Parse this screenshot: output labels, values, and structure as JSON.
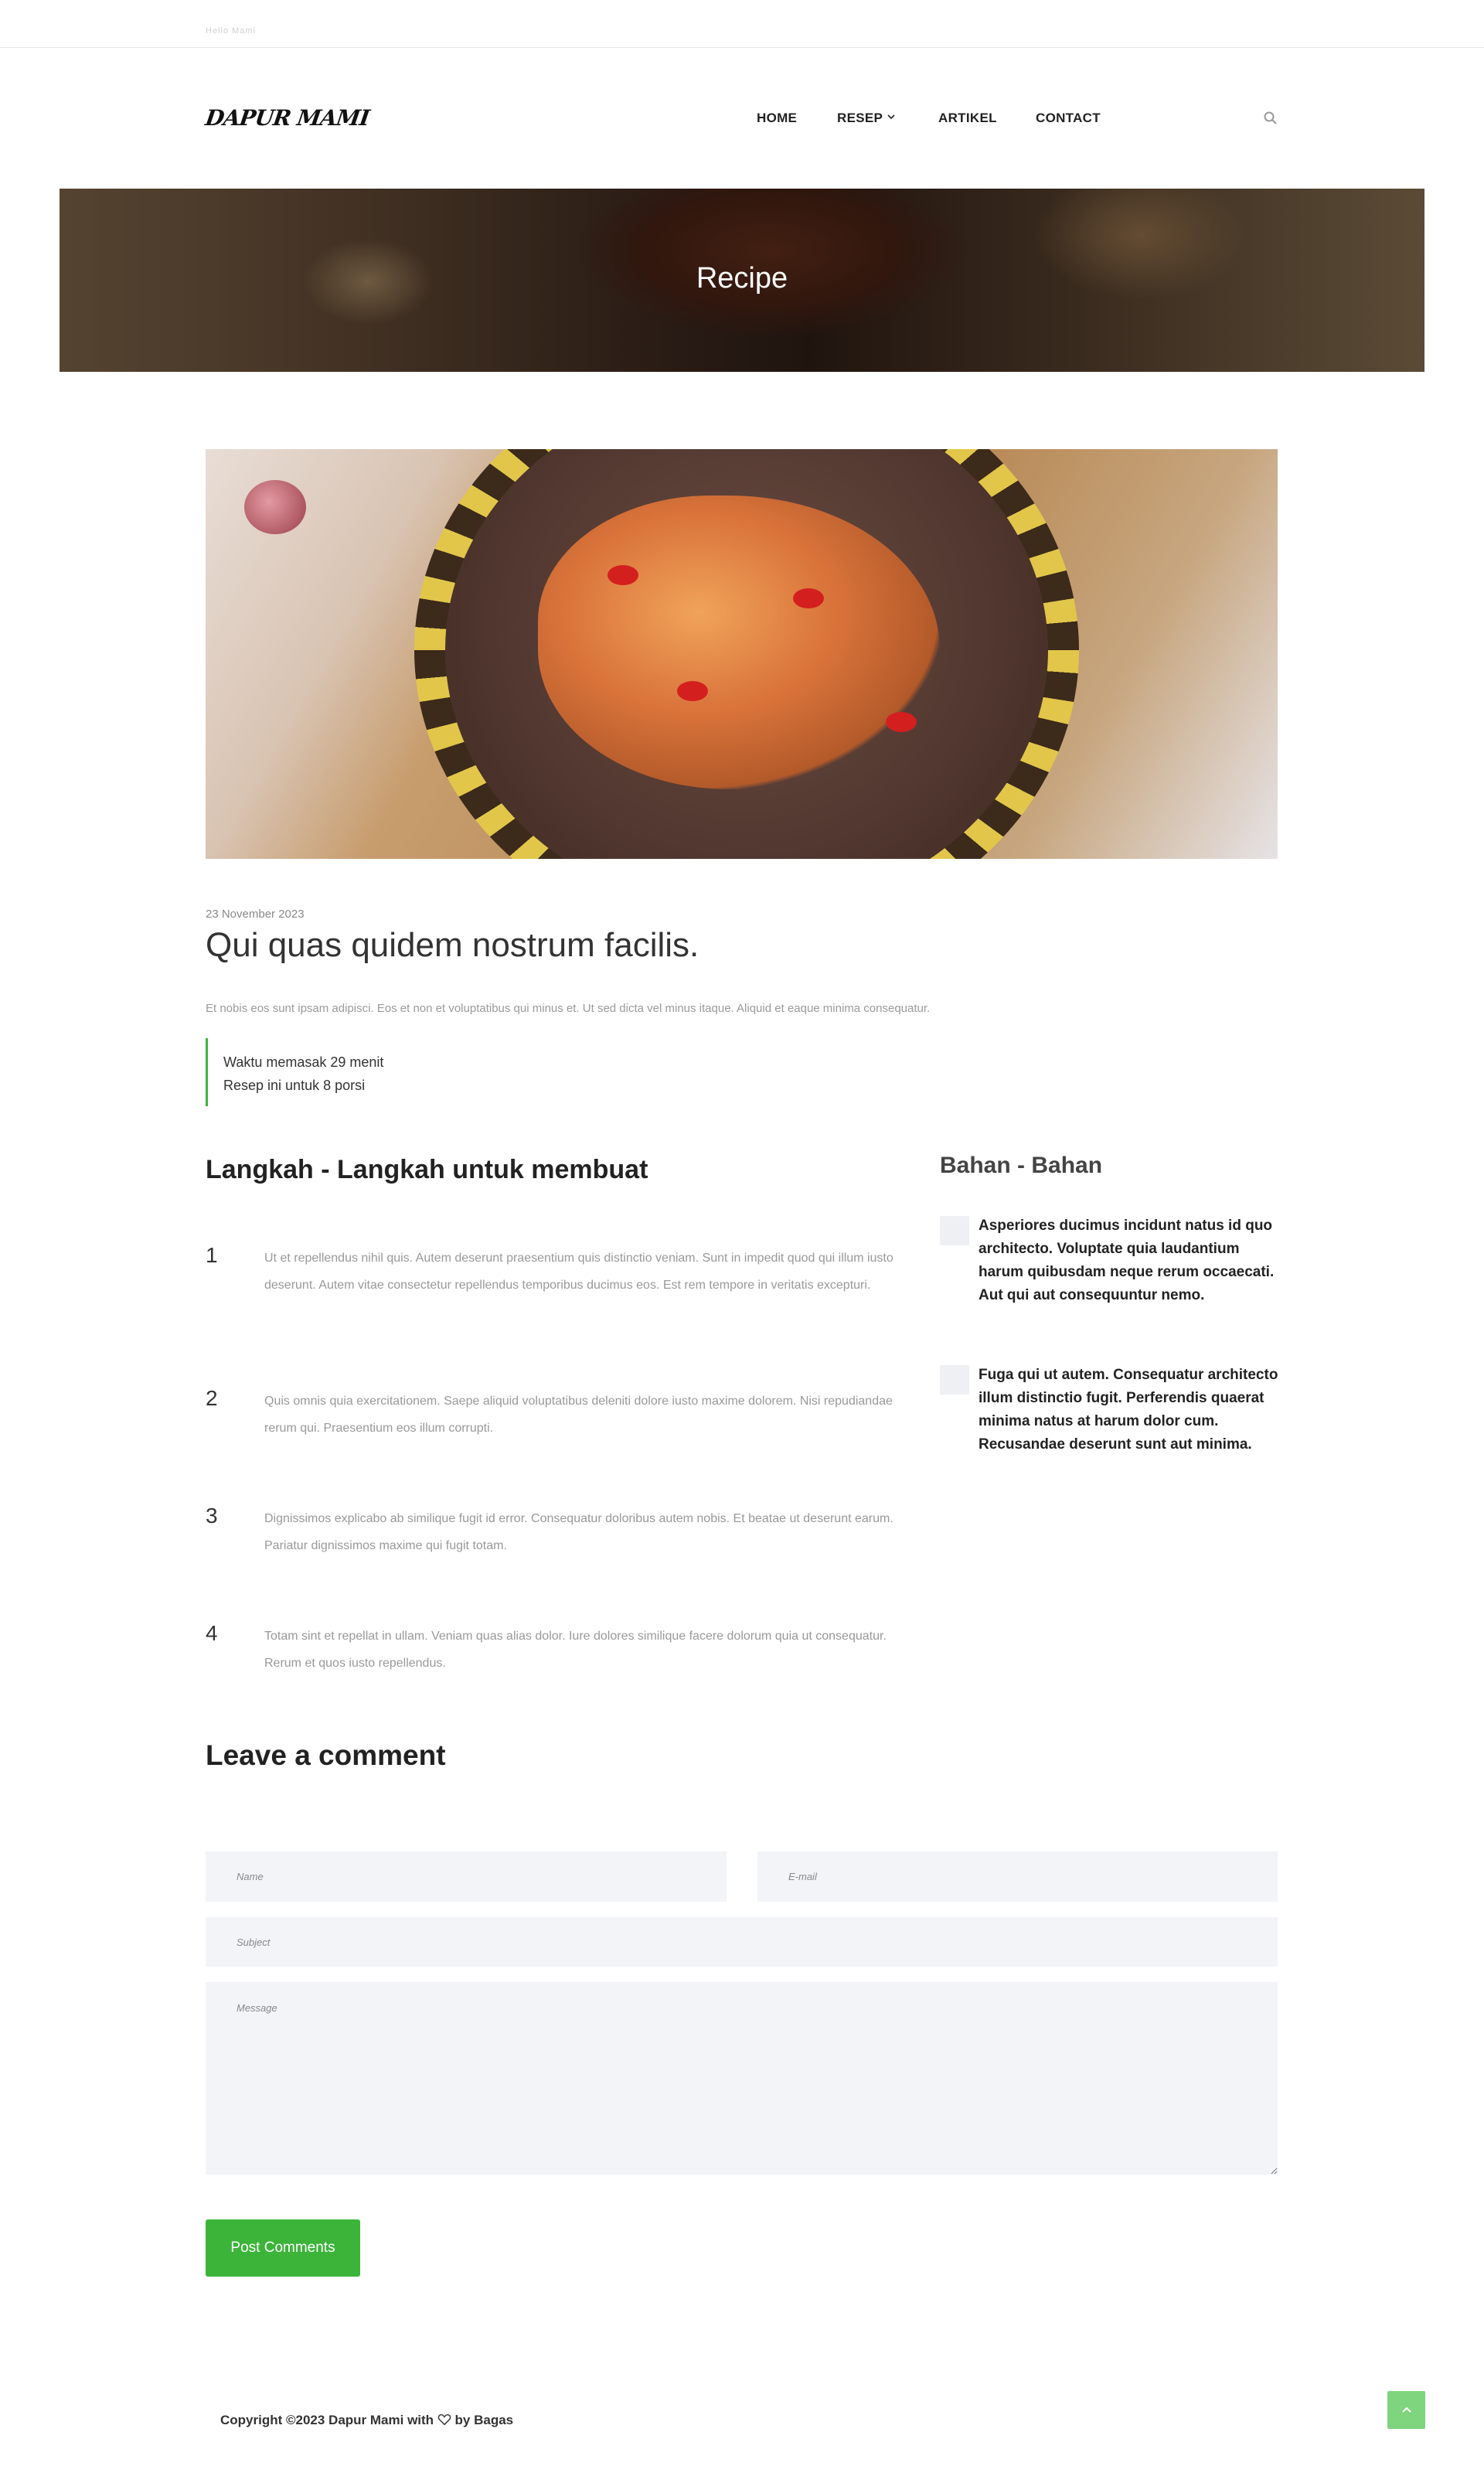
{
  "topbar": {
    "tiny_text": "Hello Mami"
  },
  "brand": {
    "logo": "DAPUR MAMI"
  },
  "nav": {
    "items": [
      {
        "label": "HOME"
      },
      {
        "label": "RESEP"
      },
      {
        "label": "ARTIKEL"
      },
      {
        "label": "CONTACT"
      }
    ],
    "search_icon": "search-icon"
  },
  "hero": {
    "title": "Recipe"
  },
  "post": {
    "date": "23 November 2023",
    "title": "Qui quas quidem nostrum facilis.",
    "excerpt": "Et nobis eos sunt ipsam adipisci. Eos et non et voluptatibus qui minus et. Ut sed dicta vel minus itaque. Aliquid et eaque minima consequatur.",
    "cook_time": "Waktu memasak 29 menit",
    "servings": "Resep ini untuk 8 porsi"
  },
  "steps": {
    "title": "Langkah - Langkah untuk membuat",
    "items": [
      {
        "num": "1",
        "text": "Ut et repellendus nihil quis. Autem deserunt praesentium quis distinctio veniam. Sunt in impedit quod qui illum iusto deserunt. Autem vitae consectetur repellendus temporibus ducimus eos. Est rem tempore in veritatis excepturi."
      },
      {
        "num": "2",
        "text": "Quis omnis quia exercitationem. Saepe aliquid voluptatibus deleniti dolore iusto maxime dolorem. Nisi repudiandae rerum qui. Praesentium eos illum corrupti."
      },
      {
        "num": "3",
        "text": "Dignissimos explicabo ab similique fugit id error. Consequatur doloribus autem nobis. Et beatae ut deserunt earum. Pariatur dignissimos maxime qui fugit totam."
      },
      {
        "num": "4",
        "text": "Totam sint et repellat in ullam. Veniam quas alias dolor. Iure dolores similique facere dolorum quia ut consequatur. Rerum et quos iusto repellendus."
      }
    ]
  },
  "ingredients": {
    "title": "Bahan - Bahan",
    "items": [
      {
        "text": "Asperiores ducimus incidunt natus id quo architecto. Voluptate quia laudantium harum quibusdam neque rerum occaecati. Aut qui aut consequuntur nemo."
      },
      {
        "text": "Fuga qui ut autem. Consequatur architecto illum distinctio fugit. Perferendis quaerat minima natus at harum dolor cum. Recusandae deserunt sunt aut minima."
      }
    ]
  },
  "comment_form": {
    "title": "Leave a comment",
    "name_placeholder": "Name",
    "email_placeholder": "E-mail",
    "subject_placeholder": "Subject",
    "message_placeholder": "Message",
    "submit_label": "Post Comments"
  },
  "footer": {
    "copyright_prefix": "Copyright ©2023 Dapur Mami with",
    "copyright_suffix": "by Bagas"
  },
  "colors": {
    "accent": "#3cb43a",
    "to_top_button": "#7fd47e",
    "field_bg": "#f3f4f8"
  }
}
